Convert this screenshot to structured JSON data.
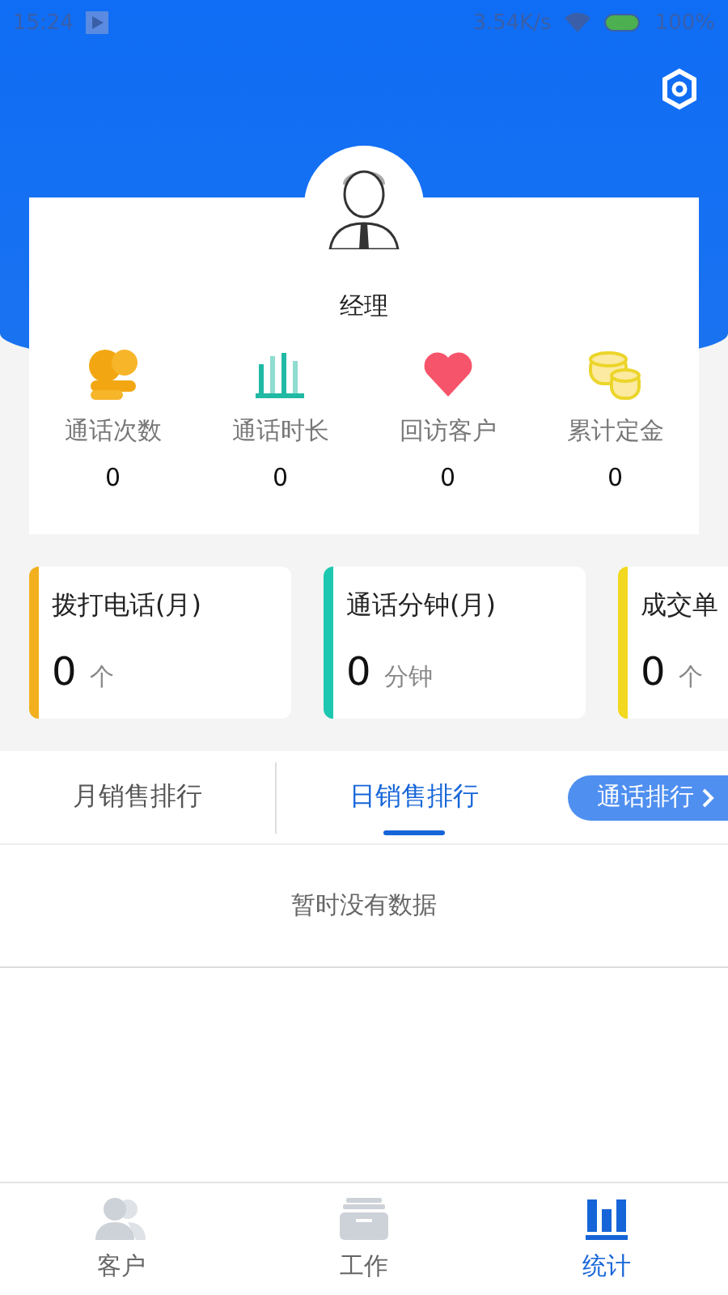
{
  "status_bar": {
    "time": "15:24",
    "speed": "3.54K/s",
    "battery": "100%"
  },
  "profile": {
    "name": "经理"
  },
  "stats": [
    {
      "kind": "calls",
      "label": "通话次数",
      "value": "0"
    },
    {
      "kind": "duration",
      "label": "通话时长",
      "value": "0"
    },
    {
      "kind": "revisit",
      "label": "回访客户",
      "value": "0"
    },
    {
      "kind": "deposit",
      "label": "累计定金",
      "value": "0"
    }
  ],
  "cards": [
    {
      "title": "拨打电话(月)",
      "value": "0",
      "unit": "个",
      "color": "#f2b01e"
    },
    {
      "title": "通话分钟(月)",
      "value": "0",
      "unit": "分钟",
      "color": "#1ec8b0"
    },
    {
      "title": "成交单",
      "value": "0",
      "unit": "个",
      "color": "#f2d81e"
    }
  ],
  "tabs": [
    {
      "label": "月销售排行",
      "selected": false
    },
    {
      "label": "日销售排行",
      "selected": true
    }
  ],
  "ranking_button": {
    "label": "通话排行"
  },
  "empty_message": "暂时没有数据",
  "bottom_nav": [
    {
      "kind": "customers",
      "label": "客户",
      "selected": false
    },
    {
      "kind": "work",
      "label": "工作",
      "selected": false
    },
    {
      "kind": "stats",
      "label": "统计",
      "selected": true
    }
  ]
}
